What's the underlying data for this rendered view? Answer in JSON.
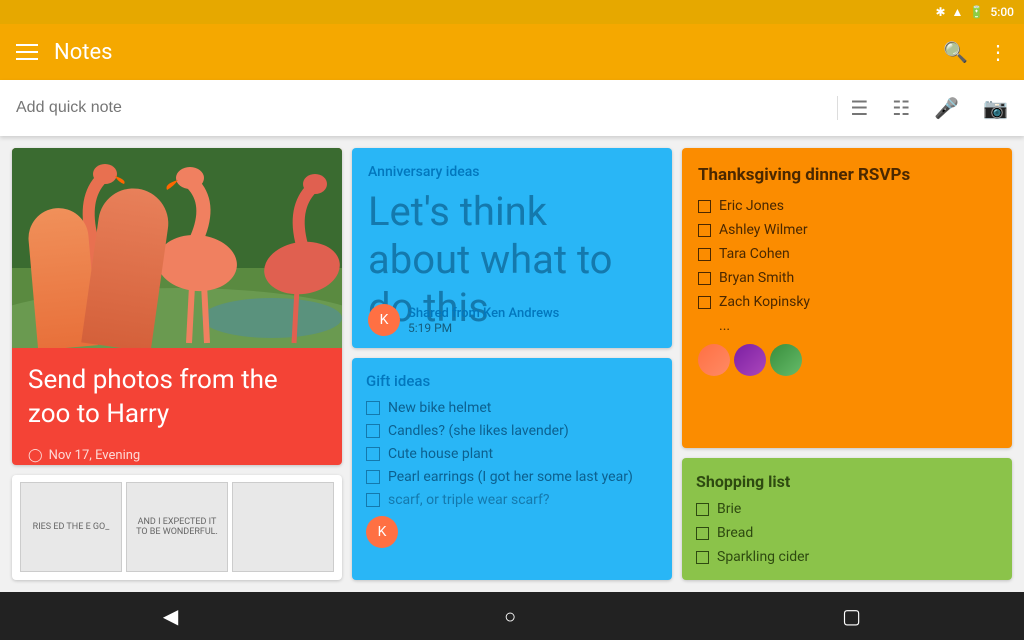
{
  "statusBar": {
    "time": "5:00",
    "icons": [
      "bluetooth",
      "signal",
      "battery"
    ]
  },
  "toolbar": {
    "title": "Notes",
    "searchIcon": "🔍",
    "moreIcon": "⋮"
  },
  "quickNote": {
    "placeholder": "Add quick note",
    "icons": [
      "text",
      "list",
      "mic",
      "camera"
    ]
  },
  "notes": {
    "flamingo": {
      "title": "Send photos from the zoo to Harry",
      "date": "Nov 17, Evening"
    },
    "anniversary": {
      "tag": "Anniversary ideas",
      "body": "Let's think about what to do this",
      "sharedBy": "Shared from Ken Andrews",
      "time": "5:19 PM"
    },
    "gift": {
      "title": "Gift ideas",
      "items": [
        "New bike helmet",
        "Candles? (she likes lavender)",
        "Cute house plant",
        "Pearl earrings (I got her some last year)",
        "scarf, or triple wear scarf?"
      ]
    },
    "thanksgiving": {
      "title": "Thanksgiving dinner RSVPs",
      "items": [
        "Eric Jones",
        "Ashley Wilmer",
        "Tara Cohen",
        "Bryan Smith",
        "Zach Kopinsky"
      ],
      "more": "..."
    },
    "shopping": {
      "title": "Shopping list",
      "items": [
        "Brie",
        "Bread",
        "Sparkling cider"
      ]
    }
  },
  "comic": {
    "cell1": "RIES\nED THE\nE GO_",
    "cell2": "AND I EXPECTED IT\nTO BE WONDERFUL.",
    "cell3": ""
  },
  "bottomNav": {
    "back": "◀",
    "home": "○",
    "recent": "▢"
  }
}
